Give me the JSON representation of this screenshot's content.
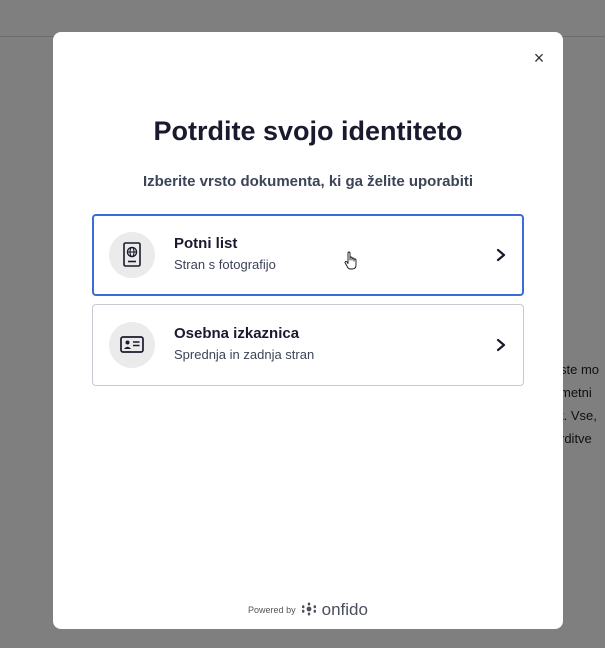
{
  "background": {
    "text_lines": [
      "ste mo",
      "metni",
      "t. Vse,",
      "rditve"
    ]
  },
  "modal": {
    "close_label": "×",
    "title": "Potrdite svojo identiteto",
    "subtitle": "Izberite vrsto dokumenta, ki ga želite uporabiti",
    "options": [
      {
        "label": "Potni list",
        "hint": "Stran s fotografijo",
        "icon": "passport-icon",
        "selected": true
      },
      {
        "label": "Osebna izkaznica",
        "hint": "Sprednja in zadnja stran",
        "icon": "id-card-icon",
        "selected": false
      }
    ],
    "footer": {
      "powered_by": "Powered by",
      "brand": "onfido"
    }
  },
  "colors": {
    "overlay": "rgba(0,0,0,0.5)",
    "selected_border": "#3b6cd4",
    "title": "#1a1a2e",
    "icon_bg": "#ebebeb"
  }
}
